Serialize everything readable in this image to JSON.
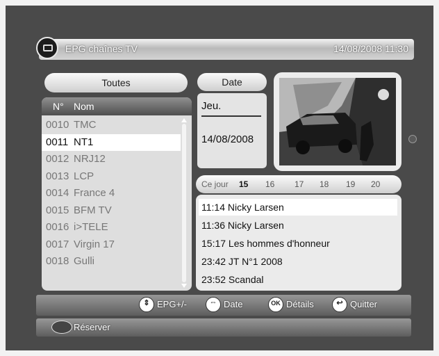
{
  "header": {
    "title": "EPG chaînes TV",
    "datetime": "14/08/2008 11:30"
  },
  "filter": {
    "label": "Toutes"
  },
  "channels": {
    "col_num": "N°",
    "col_name": "Nom",
    "items": [
      {
        "num": "0010",
        "name": "TMC"
      },
      {
        "num": "0011",
        "name": "NT1"
      },
      {
        "num": "0012",
        "name": "NRJ12"
      },
      {
        "num": "0013",
        "name": "LCP"
      },
      {
        "num": "0014",
        "name": "France 4"
      },
      {
        "num": "0015",
        "name": "BFM TV"
      },
      {
        "num": "0016",
        "name": "i>TELE"
      },
      {
        "num": "0017",
        "name": "Virgin 17"
      },
      {
        "num": "0018",
        "name": "Gulli"
      }
    ],
    "selected_index": 1
  },
  "date_panel": {
    "button_label": "Date",
    "day": "Jeu.",
    "date": "14/08/2008"
  },
  "timeline": {
    "label": "Ce jour",
    "hours": [
      "15",
      "16",
      "17",
      "18",
      "19",
      "20"
    ],
    "current_hour": "15"
  },
  "programs": {
    "items": [
      {
        "text": "11:14 Nicky Larsen"
      },
      {
        "text": "11:36 Nicky Larsen"
      },
      {
        "text": "15:17 Les hommes d'honneur"
      },
      {
        "text": "23:42 JT N°1 2008"
      },
      {
        "text": "23:52 Scandal"
      }
    ],
    "selected_index": 0
  },
  "actions": {
    "items": [
      {
        "icon": "nav-updown-icon",
        "label": "EPG+/-"
      },
      {
        "icon": "nav-leftright-icon",
        "label": "Date"
      },
      {
        "icon": "ok-icon",
        "label": "Détails"
      },
      {
        "icon": "exit-icon",
        "label": "Quitter"
      }
    ],
    "reserve_label": "Réserver"
  },
  "colors": {
    "background": "#4a4a4a",
    "panel": "#dedede",
    "selected_row": "#ffffff"
  }
}
